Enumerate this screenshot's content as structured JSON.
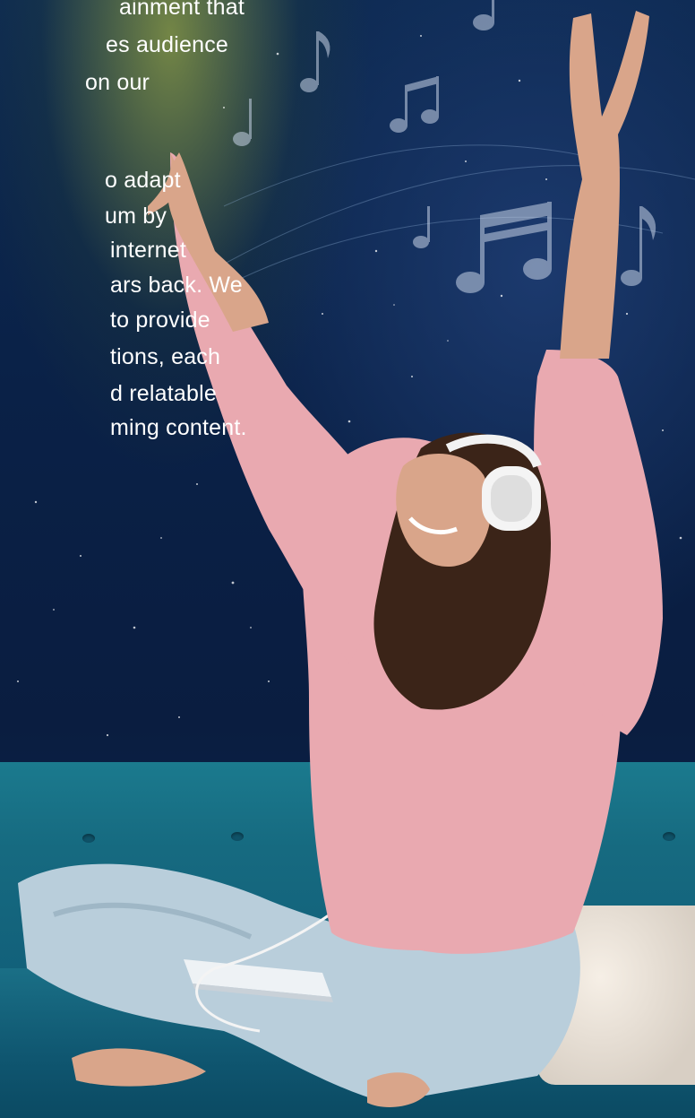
{
  "paragraph_1": {
    "lines": [
      "ainment that",
      "es audience",
      " on our"
    ]
  },
  "paragraph_2": {
    "lines": [
      "o adapt",
      "um by",
      "internet",
      "ars back. We",
      "to provide",
      "tions, each",
      "d relatable",
      "ming content."
    ]
  },
  "colors": {
    "night_sky": "#0a2147",
    "sofa_teal": "#166a80",
    "sweater_pink": "#e9a9b0",
    "jeans_blue": "#b9cedb",
    "text": "#ffffff"
  },
  "icons": [
    "music-note-icon",
    "beamed-music-notes-icon",
    "headphones-icon",
    "tablet-icon",
    "pillow-icon"
  ]
}
